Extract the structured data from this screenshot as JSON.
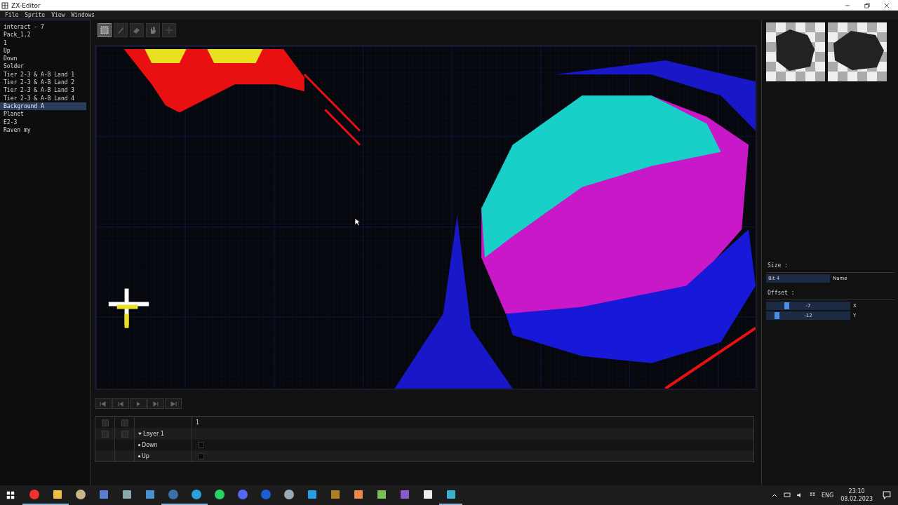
{
  "window": {
    "title": "ZX-Editor"
  },
  "menu": [
    "File",
    "Sprite",
    "View",
    "Windows"
  ],
  "sprites": [
    {
      "label": "interact - 7",
      "selected": false
    },
    {
      "label": "Pack_1.2",
      "selected": false
    },
    {
      "label": "1",
      "selected": false
    },
    {
      "label": "Up",
      "selected": false
    },
    {
      "label": "Down",
      "selected": false
    },
    {
      "label": "Solder",
      "selected": false
    },
    {
      "label": "Tier 2-3 & A-B Land 1",
      "selected": false
    },
    {
      "label": "Tier 2-3 & A-B Land 2",
      "selected": false
    },
    {
      "label": "Tier 2-3 & A-B Land 3",
      "selected": false
    },
    {
      "label": "Tier 2-3 & A-B Land 4",
      "selected": false
    },
    {
      "label": "Background A",
      "selected": true
    },
    {
      "label": "Planet",
      "selected": false
    },
    {
      "label": "E2-3",
      "selected": false
    },
    {
      "label": "Raven my",
      "selected": false
    }
  ],
  "tools": [
    {
      "kind": "select",
      "selected": true
    },
    {
      "kind": "pencil",
      "selected": false
    },
    {
      "kind": "eraser",
      "selected": false
    },
    {
      "kind": "hand",
      "selected": false
    },
    {
      "kind": "move",
      "selected": false
    }
  ],
  "properties": {
    "size_label": "Size :",
    "size_value": "Bit 4",
    "name_label": "Name",
    "offset_label": "Offset :",
    "offsets": [
      {
        "value": "-7",
        "axis": "X",
        "level": 0.22
      },
      {
        "value": "-12",
        "axis": "Y",
        "level": 0.1
      }
    ]
  },
  "playback": [
    {
      "kind": "first"
    },
    {
      "kind": "prev"
    },
    {
      "kind": "play"
    },
    {
      "kind": "next"
    },
    {
      "kind": "last"
    }
  ],
  "timeline": {
    "frame_header": "1",
    "layer": {
      "label": "Layer 1",
      "expanded": true,
      "children": [
        {
          "label": "Down"
        },
        {
          "label": "Up"
        }
      ]
    }
  },
  "taskbar": {
    "apps": [
      {
        "running": true
      },
      {
        "running": true
      },
      {
        "running": false
      },
      {
        "running": false
      },
      {
        "running": false
      },
      {
        "running": false
      },
      {
        "running": true
      },
      {
        "running": true
      },
      {
        "running": false
      },
      {
        "running": false
      },
      {
        "running": false
      },
      {
        "running": false
      },
      {
        "running": false
      },
      {
        "running": false
      },
      {
        "running": false
      },
      {
        "running": false
      },
      {
        "running": false
      },
      {
        "running": false
      },
      {
        "running": true
      }
    ],
    "language": "ENG",
    "time": "23:10",
    "date": "08.02.2023"
  }
}
